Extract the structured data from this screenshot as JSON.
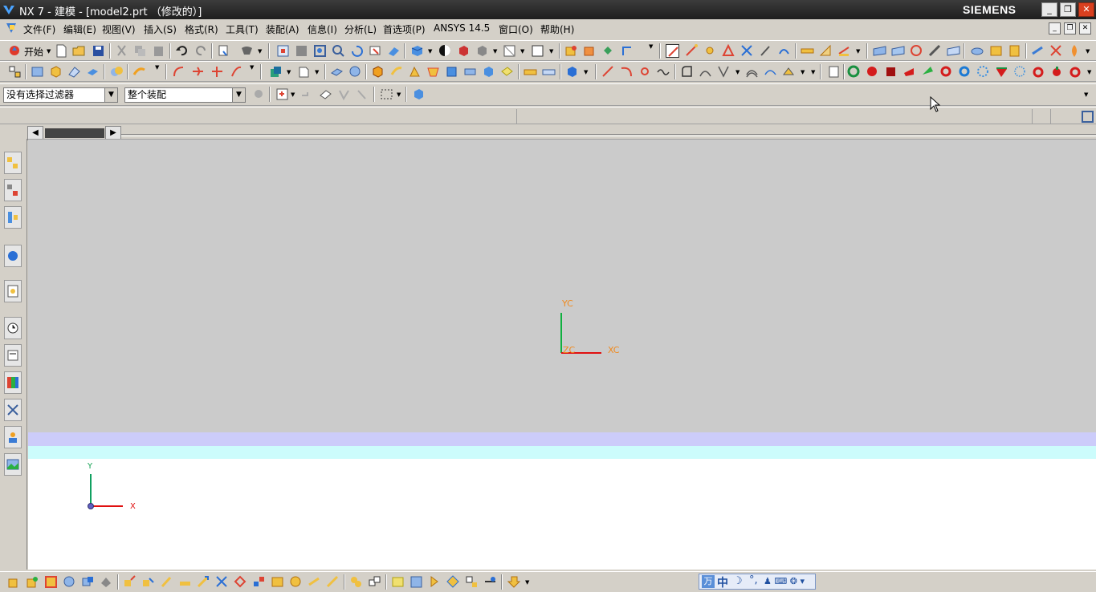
{
  "window": {
    "title": "NX 7 - 建模 - [model2.prt （修改的）]",
    "brand": "SIEMENS",
    "min_glyph": "_",
    "max_glyph": "❐",
    "close_glyph": "✕"
  },
  "menubar": {
    "items": [
      "文件(F)",
      "编辑(E)",
      "视图(V)",
      "插入(S)",
      "格式(R)",
      "工具(T)",
      "装配(A)",
      "信息(I)",
      "分析(L)",
      "首选项(P)",
      "ANSYS 14.5",
      "窗口(O)",
      "帮助(H)"
    ]
  },
  "toolbar": {
    "start_label": "开始",
    "selection_filter": "没有选择过滤器",
    "selection_scope": "整个装配"
  },
  "viewport": {
    "wcs_labels": {
      "yc": "YC",
      "xc": "XC",
      "zc": "ZC"
    },
    "background_color": "#cbcbcb",
    "accent_label_color": "#f08a1e"
  },
  "lower_view": {
    "x_label": "X",
    "y_label": "Y"
  },
  "ime": {
    "wan": "万",
    "lang": "中",
    "moon": "☽",
    "punct": "°,",
    "tools": "♟ ⌨ ❂ ▾"
  },
  "colors": {
    "x_axis": "#e01010",
    "y_axis": "#10b040",
    "band_primary": "#ccccfa",
    "band_secondary": "#ccfcfc"
  }
}
